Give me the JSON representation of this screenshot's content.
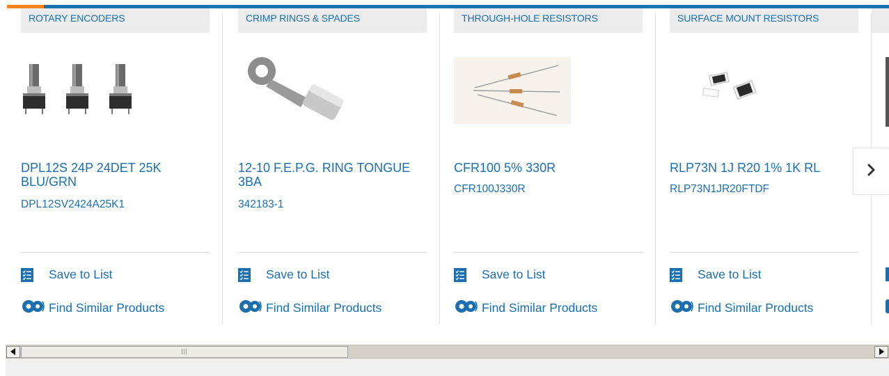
{
  "carousel": {
    "cards": [
      {
        "category": "ROTARY ENCODERS",
        "title": "DPL12S 24P 24DET 25K BLU/GRN",
        "part_number": "DPL12SV2424A25K1",
        "save_label": "Save to List",
        "find_label": "Find Similar Products"
      },
      {
        "category": "CRIMP RINGS & SPADES",
        "title": "12-10 F.E.P.G. RING TONGUE 3BA",
        "part_number": "342183-1",
        "save_label": "Save to List",
        "find_label": "Find Similar Products"
      },
      {
        "category": "THROUGH-HOLE RESISTORS",
        "title": "CFR100 5% 330R",
        "part_number": "CFR100J330R",
        "save_label": "Save to List",
        "find_label": "Find Similar Products"
      },
      {
        "category": "SURFACE MOUNT RESISTORS",
        "title": "RLP73N 1J R20 1% 1K RL",
        "part_number": "RLP73N1JR20FTDF",
        "save_label": "Save to List",
        "find_label": "Find Similar Products"
      }
    ],
    "next_icon": "chevron-right-icon"
  },
  "colors": {
    "link": "#1a6fb0",
    "accent_bar": "#1a73b0",
    "accent_orange": "#f5821f",
    "category_bg": "#ececec"
  }
}
